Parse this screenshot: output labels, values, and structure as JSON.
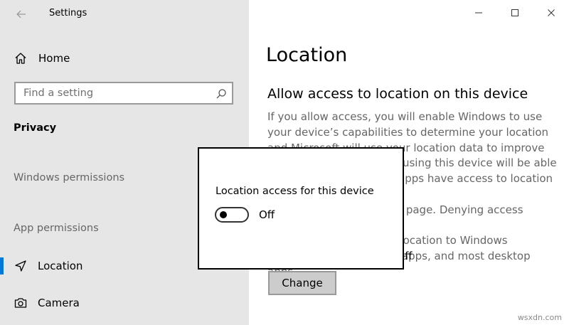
{
  "window": {
    "app_title": "Settings",
    "controls": {
      "minimize": "minimize-icon",
      "maximize": "maximize-icon",
      "close": "close-icon"
    }
  },
  "sidebar": {
    "back_icon": "back-arrow-icon",
    "home_label": "Home",
    "search_placeholder": "Find a setting",
    "section_title": "Privacy",
    "groups": [
      {
        "heading": "Windows permissions"
      },
      {
        "heading": "App permissions"
      }
    ],
    "items": [
      {
        "label": "Location",
        "icon": "location-icon",
        "selected": true
      },
      {
        "label": "Camera",
        "icon": "camera-icon",
        "selected": false
      }
    ]
  },
  "main": {
    "page_title": "Location",
    "sub_title": "Allow access to location on this device",
    "paragraph_lines": [
      "If you allow access, you will enable Windows to use",
      "your device’s capabilities to determine your location",
      "and Microsoft will use your location data to improve",
      "location services. People using this device will be able",
      "to choose whether their apps have access to location by",
      "using the settings on this page. Denying access blocks",
      "Windows from providing location to Windows",
      "features, Microsoft Store apps, and most desktop apps."
    ],
    "status_tail": "off",
    "change_button": "Change"
  },
  "dialog": {
    "title": "Location access for this device",
    "toggle_label": "Off",
    "toggle_state": "off"
  },
  "watermark": "wsxdn.com",
  "colors": {
    "sidebar_bg": "#e6e6e6",
    "accent": "#0078d7",
    "button_bg": "#cccccc",
    "secondary_text": "#666666"
  }
}
